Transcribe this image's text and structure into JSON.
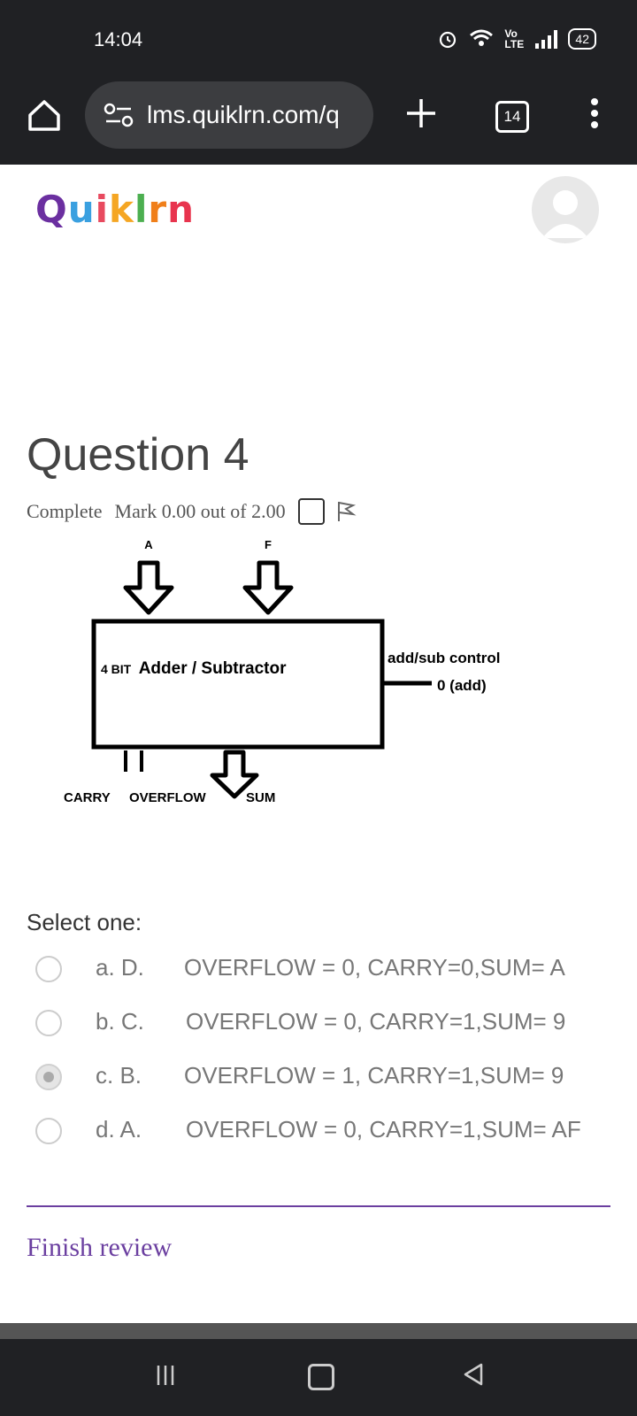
{
  "status_bar": {
    "time": "14:04",
    "network": "Vo LTE",
    "battery": "42"
  },
  "browser": {
    "url": "lms.quiklrn.com/q",
    "tab_count": "14"
  },
  "brand": {
    "logo_text": "Quiklrn",
    "logo_colors": [
      "#6b2fa0",
      "#3aa0e0",
      "#e84a5f",
      "#f5a623",
      "#4caf50",
      "#f07f1a",
      "#e8344e"
    ]
  },
  "question": {
    "title": "Question 4",
    "status": "Complete",
    "mark": "Mark 0.00 out of 2.00"
  },
  "diagram": {
    "input_a": "A",
    "input_f": "F",
    "box_label_prefix": "4 BIT",
    "box_label": "Adder / Subtractor",
    "control_label": "add/sub control",
    "control_value": "0 (add)",
    "out_carry": "CARRY",
    "out_overflow": "OVERFLOW",
    "out_sum": "SUM"
  },
  "answers": {
    "prompt": "Select one:",
    "options": [
      {
        "letter": "a. D.",
        "text": "OVERFLOW = 0, CARRY=0,SUM= A",
        "selected": false
      },
      {
        "letter": "b. C.",
        "text": "OVERFLOW = 0, CARRY=1,SUM= 9",
        "selected": false
      },
      {
        "letter": "c. B.",
        "text": "OVERFLOW = 1, CARRY=1,SUM= 9",
        "selected": true
      },
      {
        "letter": "d. A.",
        "text": "OVERFLOW = 0, CARRY=1,SUM= AF",
        "selected": false
      }
    ]
  },
  "footer": {
    "finish_review": "Finish review"
  },
  "colors": {
    "accent": "#6b3fa0",
    "chrome": "#202124"
  }
}
